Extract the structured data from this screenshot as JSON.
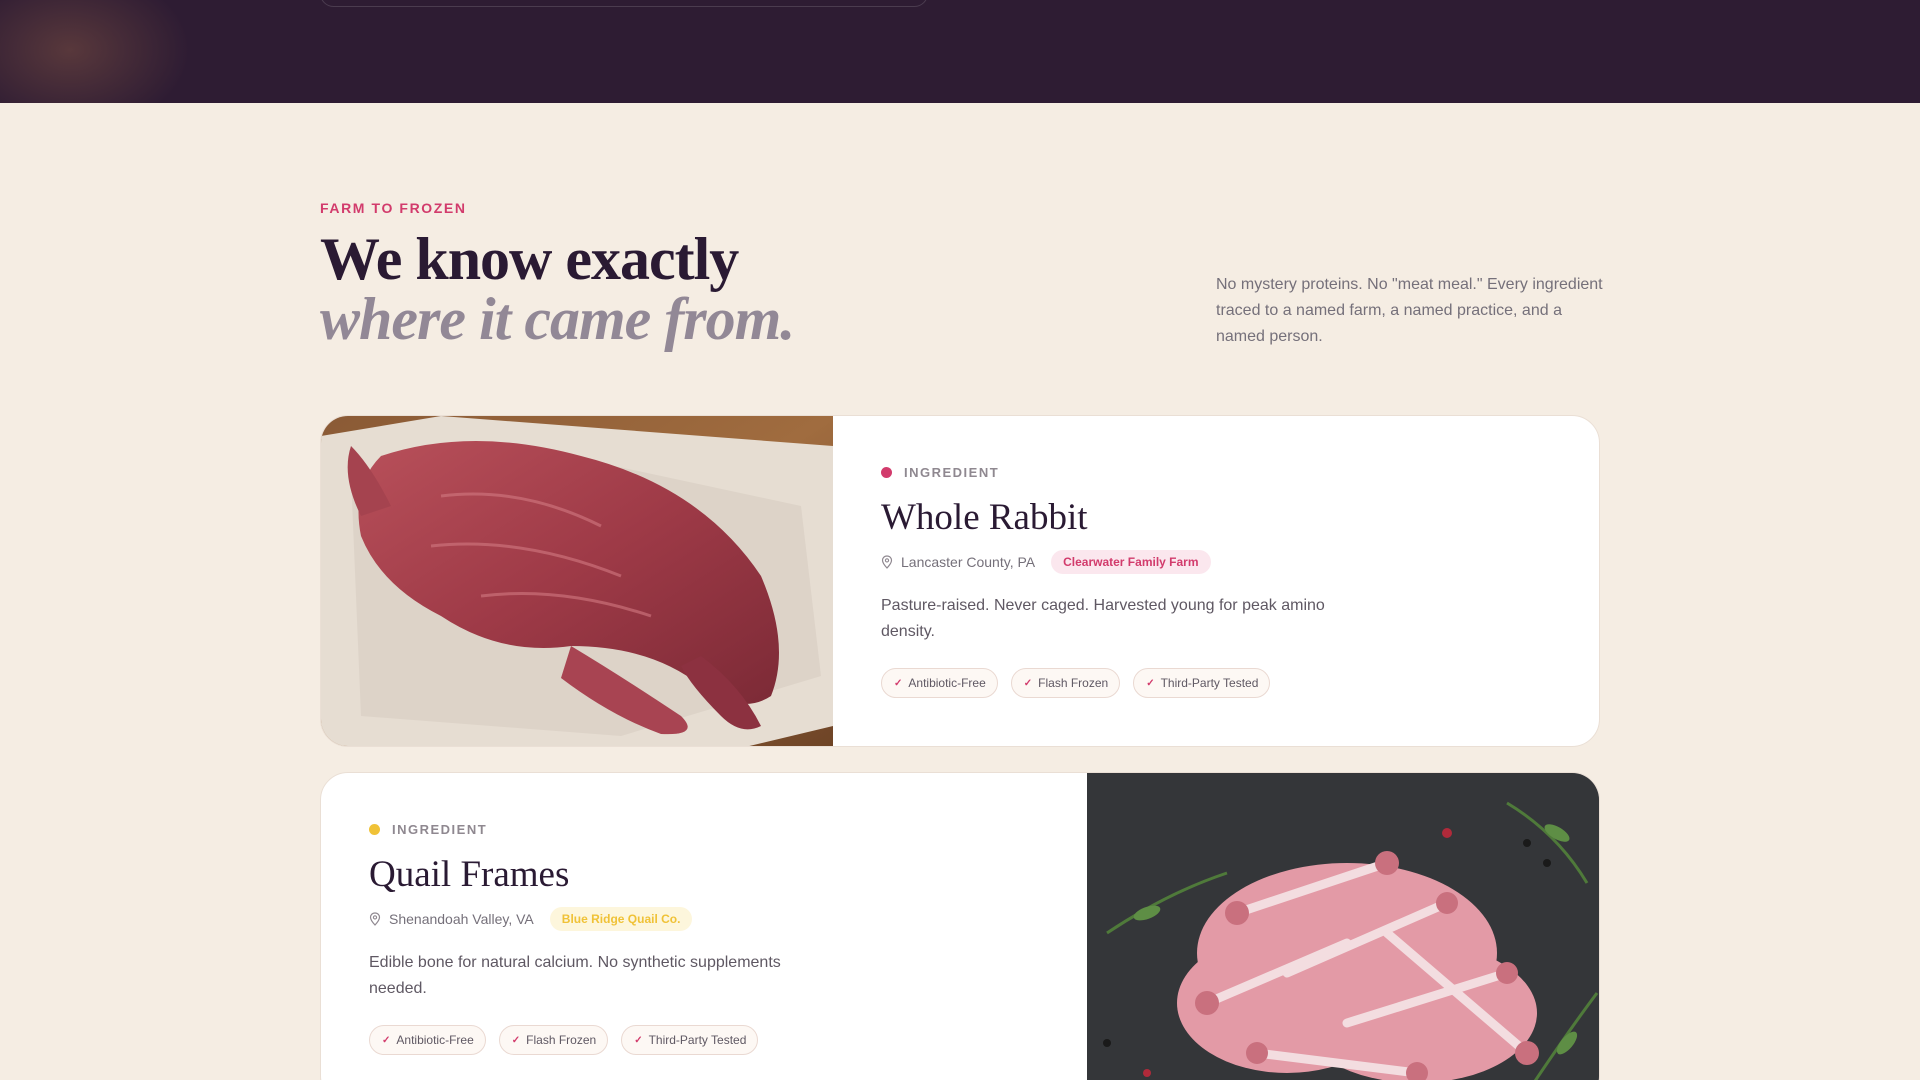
{
  "section": {
    "eyebrow": "FARM TO FROZEN",
    "headline_line1": "We know exactly",
    "headline_line2": "where it came from.",
    "intro": "No mystery proteins. No \"meat meal.\" Every ingredient traced to a named farm, a named practice, and a named person."
  },
  "ingredients": [
    {
      "tag": "INGREDIENT",
      "dot_color": "#d23b6c",
      "name": "Whole Rabbit",
      "location": "Lancaster County, PA",
      "farm": "Clearwater Family Farm",
      "description": "Pasture-raised. Never caged. Harvested young for peak amino density.",
      "badges": [
        "Antibiotic-Free",
        "Flash Frozen",
        "Third-Party Tested"
      ],
      "image_icon": "rabbit-meat-photo"
    },
    {
      "tag": "INGREDIENT",
      "dot_color": "#f0c237",
      "name": "Quail Frames",
      "location": "Shenandoah Valley, VA",
      "farm": "Blue Ridge Quail Co.",
      "description": "Edible bone for natural calcium. No synthetic supplements needed.",
      "badges": [
        "Antibiotic-Free",
        "Flash Frozen",
        "Third-Party Tested"
      ],
      "image_icon": "quail-frames-photo"
    }
  ],
  "colors": {
    "accent": "#d23b6c",
    "secondary_accent": "#f0c237",
    "dark_band": "#2e1c33",
    "background": "#f5ede3"
  }
}
